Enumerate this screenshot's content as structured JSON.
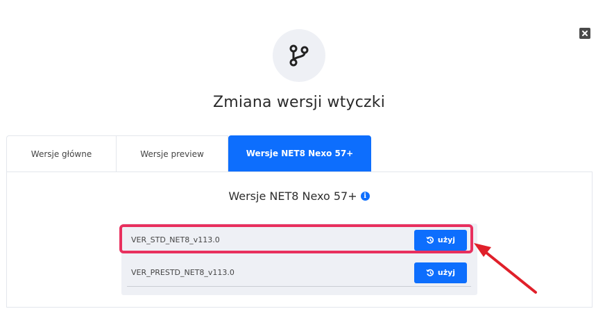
{
  "modal": {
    "title": "Zmiana wersji wtyczki",
    "header_icon": "git-branch-icon",
    "close_icon": "close-icon"
  },
  "tabs": [
    {
      "label": "Wersje główne",
      "active": false
    },
    {
      "label": "Wersje preview",
      "active": false
    },
    {
      "label": "Wersje NET8 Nexo 57+",
      "active": true
    }
  ],
  "panel": {
    "title": "Wersje NET8 Nexo 57+",
    "info_icon": "info-icon",
    "versions": [
      {
        "name": "VER_STD_NET8_v113.0",
        "button_label": "użyj",
        "button_icon": "history-icon",
        "highlighted": true
      },
      {
        "name": "VER_PRESTD_NET8_v113.0",
        "button_label": "użyj",
        "button_icon": "history-icon",
        "highlighted": false
      }
    ]
  },
  "colors": {
    "accent": "#0d6efd",
    "highlight": "#e8305e",
    "arrow": "#e0202a",
    "list_bg": "#eef0f5"
  }
}
